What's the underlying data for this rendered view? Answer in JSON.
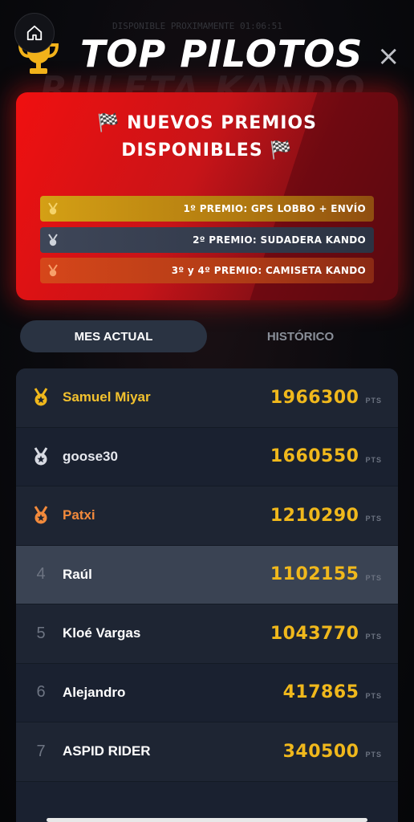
{
  "header": {
    "title": "TOP PILOTOS",
    "background_text": "RULETA KANDO",
    "countdown": "DISPONIBLE PROXIMAMENTE 01:06:51",
    "close_label": "×"
  },
  "promo": {
    "line1": "🏁 NUEVOS PREMIOS",
    "line2": "DISPONIBLES 🏁",
    "prizes": [
      {
        "label": "1º PREMIO: GPS LOBBO + ENVÍO",
        "icon": "gold-medal-icon"
      },
      {
        "label": "2º PREMIO: SUDADERA KANDO",
        "icon": "silver-medal-icon"
      },
      {
        "label": "3º y 4º PREMIO: CAMISETA KANDO",
        "icon": "bronze-medal-icon"
      }
    ]
  },
  "tabs": [
    {
      "label": "MES ACTUAL",
      "active": true
    },
    {
      "label": "HISTÓRICO",
      "active": false
    }
  ],
  "leaderboard": {
    "pts_label": "PTS",
    "rows": [
      {
        "rank": "1",
        "name": "Samuel Miyar",
        "points": "1966300",
        "medal": "gold"
      },
      {
        "rank": "2",
        "name": "goose30",
        "points": "1660550",
        "medal": "silver"
      },
      {
        "rank": "3",
        "name": "Patxi",
        "points": "1210290",
        "medal": "bronze"
      },
      {
        "rank": "4",
        "name": "Raúl",
        "points": "1102155",
        "medal": ""
      },
      {
        "rank": "5",
        "name": "Kloé Vargas",
        "points": "1043770",
        "medal": ""
      },
      {
        "rank": "6",
        "name": "Alejandro",
        "points": "417865",
        "medal": ""
      },
      {
        "rank": "7",
        "name": "ASPID RIDER",
        "points": "340500",
        "medal": ""
      }
    ]
  },
  "colors": {
    "accent_red": "#e01515",
    "gold": "#f0b81c",
    "silver": "#d7dae2",
    "bronze": "#f28a3c",
    "panel": "#1b2230"
  }
}
